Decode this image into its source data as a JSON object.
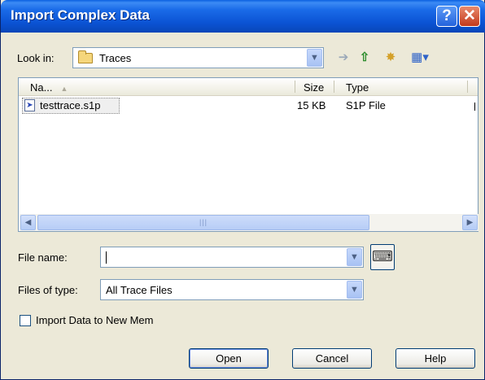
{
  "window": {
    "title": "Import Complex Data",
    "help_glyph": "?",
    "close_glyph": "✕"
  },
  "look_in": {
    "label": "Look in:",
    "value": "Traces"
  },
  "toolbar_icons": [
    "back-icon",
    "up-folder-icon",
    "new-folder-icon",
    "views-menu-icon"
  ],
  "file_list": {
    "columns": [
      {
        "label": "Na..."
      },
      {
        "label": "Size"
      },
      {
        "label": "Type"
      }
    ],
    "rows": [
      {
        "name": "testtrace.s1p",
        "size": "15 KB",
        "type": "S1P File"
      }
    ]
  },
  "file_name": {
    "label": "File name:",
    "value": ""
  },
  "files_of_type": {
    "label": "Files of type:",
    "value": "All Trace Files"
  },
  "import_checkbox": {
    "label": "Import Data to New Mem",
    "checked": false
  },
  "buttons": {
    "open": "Open",
    "cancel": "Cancel",
    "help": "Help"
  },
  "colors": {
    "titlebar": "#0b53d4",
    "dialog_bg": "#ece9d8",
    "close_button": "#c3391b"
  }
}
